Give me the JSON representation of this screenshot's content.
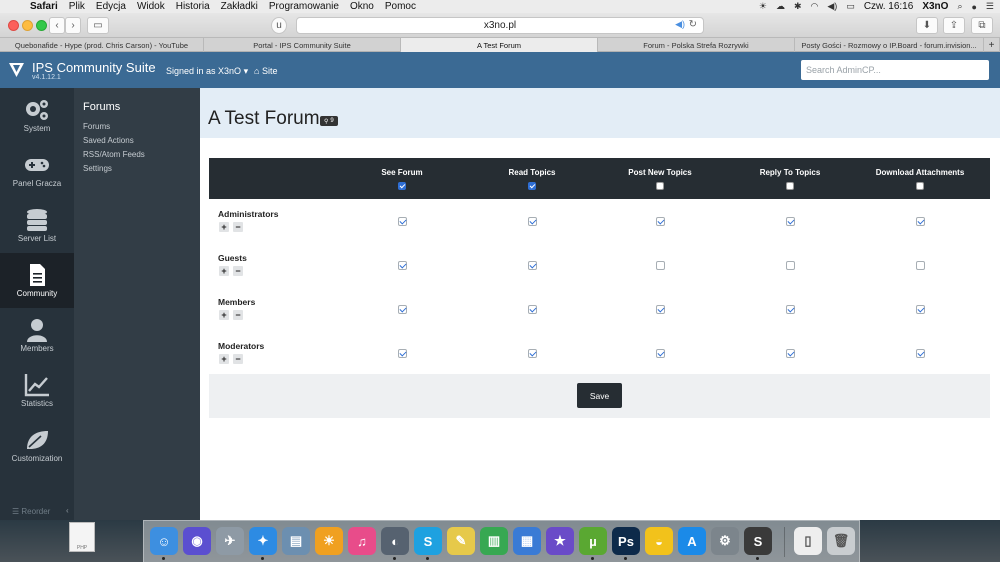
{
  "menubar": {
    "items": [
      "Safari",
      "Plik",
      "Edycja",
      "Widok",
      "Historia",
      "Zakładki",
      "Programowanie",
      "Okno",
      "Pomoc"
    ],
    "clock": "Czw. 16:16",
    "user": "X3nO"
  },
  "browser": {
    "url": "x3no.pl",
    "tabs": [
      "Quebonafide - Hype (prod. Chris Carson) - YouTube",
      "Portal - IPS Community Suite",
      "A Test Forum",
      "Forum - Polska Strefa Rozrywki",
      "Posty Gości - Rozmowy o IP.Board - forum.invision...",
      "+"
    ]
  },
  "header": {
    "suite_name": "IPS Community Suite",
    "version": "v4.1.12.1",
    "signed_in": "Signed in as X3nO",
    "site_link": "Site",
    "search_placeholder": "Search AdminCP..."
  },
  "nav": {
    "items": [
      {
        "label": "System",
        "icon": "cogs-icon"
      },
      {
        "label": "Panel Gracza",
        "icon": "gamepad-icon"
      },
      {
        "label": "Server List",
        "icon": "database-icon"
      },
      {
        "label": "Community",
        "icon": "document-icon",
        "active": true
      },
      {
        "label": "Members",
        "icon": "user-icon"
      },
      {
        "label": "Statistics",
        "icon": "chart-icon"
      },
      {
        "label": "Customization",
        "icon": "leaf-icon"
      }
    ],
    "reorder": "Reorder"
  },
  "submenu": {
    "heading": "Forums",
    "items": [
      "Forums",
      "Saved Actions",
      "RSS/Atom Feeds",
      "Settings"
    ]
  },
  "page": {
    "title": "A Test Forum",
    "badge": "9"
  },
  "permissions": {
    "columns": [
      {
        "label": "See Forum",
        "all_checked": true
      },
      {
        "label": "Read Topics",
        "all_checked": true
      },
      {
        "label": "Post New Topics",
        "all_checked": false
      },
      {
        "label": "Reply To Topics",
        "all_checked": false
      },
      {
        "label": "Download Attachments",
        "all_checked": false
      }
    ],
    "rows": [
      {
        "group": "Administrators",
        "values": [
          true,
          true,
          true,
          true,
          true
        ]
      },
      {
        "group": "Guests",
        "values": [
          true,
          true,
          false,
          false,
          false
        ]
      },
      {
        "group": "Members",
        "values": [
          true,
          true,
          true,
          true,
          true
        ]
      },
      {
        "group": "Moderators",
        "values": [
          true,
          true,
          true,
          true,
          true
        ]
      }
    ],
    "plus": "+",
    "minus": "−"
  },
  "save_label": "Save",
  "desktop": {
    "file_label": "PHP"
  },
  "colors": {
    "header": "#3b6a94",
    "nav_bg": "#27323b",
    "accent_check": "#2e6ed5"
  }
}
